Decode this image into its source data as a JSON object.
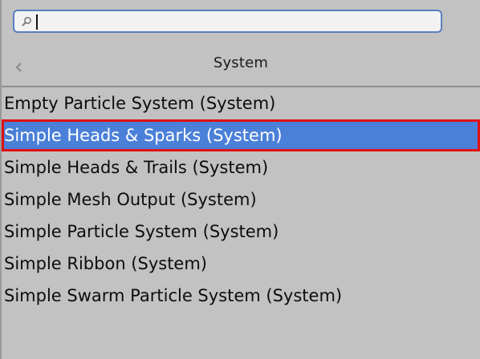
{
  "search": {
    "value": "",
    "placeholder": ""
  },
  "header": {
    "title": "System",
    "back_icon": "chevron-left-icon"
  },
  "list": {
    "selected_index": 1,
    "items": [
      {
        "label": "Empty Particle System (System)"
      },
      {
        "label": "Simple Heads & Sparks (System)"
      },
      {
        "label": "Simple Heads & Trails (System)"
      },
      {
        "label": "Simple Mesh Output (System)"
      },
      {
        "label": "Simple Particle System (System)"
      },
      {
        "label": "Simple Ribbon (System)"
      },
      {
        "label": "Simple Swarm Particle System (System)"
      }
    ]
  },
  "colors": {
    "background": "#c2c2c2",
    "selection": "#4a80d8",
    "highlight_border": "#e01010",
    "search_border": "#5a7ec2"
  }
}
